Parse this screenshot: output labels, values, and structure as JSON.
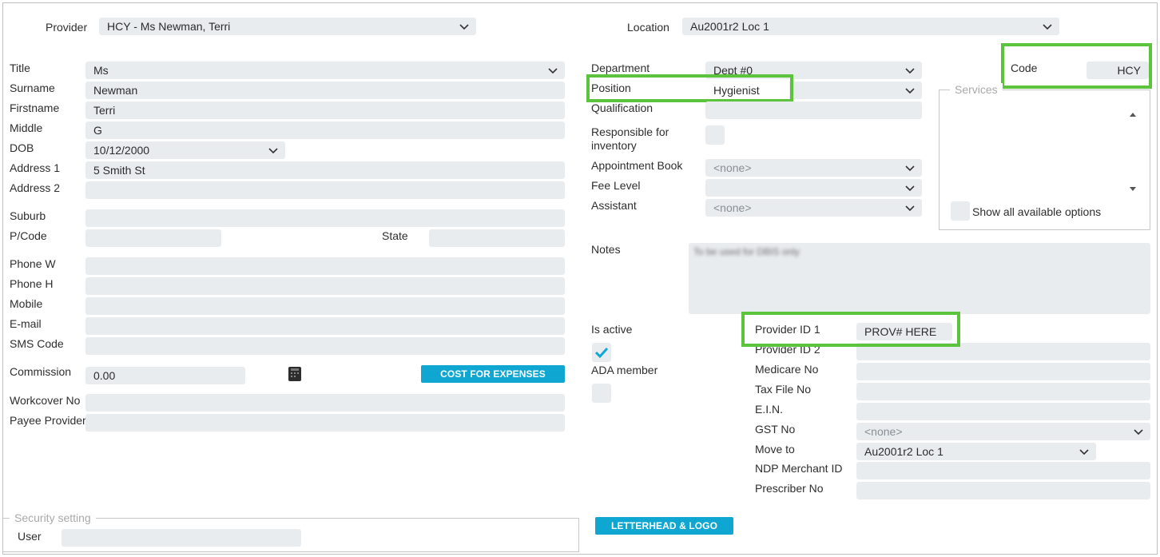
{
  "header": {
    "provider_label": "Provider",
    "provider_value": "HCY - Ms Newman, Terri",
    "location_label": "Location",
    "location_value": "Au2001r2 Loc 1"
  },
  "personal": {
    "title_label": "Title",
    "title_value": "Ms",
    "surname_label": "Surname",
    "surname_value": "Newman",
    "firstname_label": "Firstname",
    "firstname_value": "Terri",
    "middle_label": "Middle",
    "middle_value": "G",
    "dob_label": "DOB",
    "dob_value": "10/12/2000",
    "address1_label": "Address 1",
    "address1_value": "5 Smith St",
    "address2_label": "Address 2",
    "address2_value": "",
    "suburb_label": "Suburb",
    "suburb_value": "",
    "pcode_label": "P/Code",
    "pcode_value": "",
    "state_label": "State",
    "state_value": "",
    "phone_w_label": "Phone W",
    "phone_h_label": "Phone H",
    "mobile_label": "Mobile",
    "email_label": "E-mail",
    "sms_label": "SMS Code",
    "commission_label": "Commission",
    "commission_value": "0.00",
    "cost_button": "COST FOR EXPENSES",
    "workcover_label": "Workcover No",
    "payee_label": "Payee Provider"
  },
  "employment": {
    "department_label": "Department",
    "department_value": "Dept #0",
    "position_label": "Position",
    "position_value": "Hygienist",
    "qualification_label": "Qualification",
    "responsible_label_1": "Responsible for",
    "responsible_label_2": "inventory",
    "appt_book_label": "Appointment Book",
    "appt_book_value": "<none>",
    "fee_level_label": "Fee Level",
    "fee_level_value": "",
    "assistant_label": "Assistant",
    "assistant_value": "<none>",
    "notes_label": "Notes",
    "notes_value": "To be used for DBIS only"
  },
  "code": {
    "label": "Code",
    "value": "HCY"
  },
  "services": {
    "legend": "Services",
    "show_all_label": "Show all available options"
  },
  "status": {
    "is_active_label": "Is active",
    "is_active_checked": true,
    "ada_member_label": "ADA member",
    "ada_member_checked": false
  },
  "ids": {
    "provider_id1_label": "Provider ID 1",
    "provider_id1_value": "PROV# HERE",
    "provider_id2_label": "Provider ID 2",
    "medicare_label": "Medicare No",
    "taxfile_label": "Tax File No",
    "ein_label": "E.I.N.",
    "gst_label": "GST No",
    "gst_value": "<none>",
    "move_to_label": "Move to",
    "move_to_value": "Au2001r2 Loc 1",
    "ndp_label": "NDP Merchant ID",
    "prescriber_label": "Prescriber No"
  },
  "security": {
    "legend": "Security setting",
    "user_label": "User",
    "user_value": ""
  },
  "letterhead_button": "LETTERHEAD & LOGO SETUP",
  "colors": {
    "accent": "#0fa7d1",
    "highlight": "#5cc43c",
    "field_bg": "#e9ecef"
  },
  "icons": [
    "chevron-down-icon",
    "checkmark-icon",
    "calculator-icon",
    "scroll-up-icon",
    "scroll-down-icon"
  ]
}
